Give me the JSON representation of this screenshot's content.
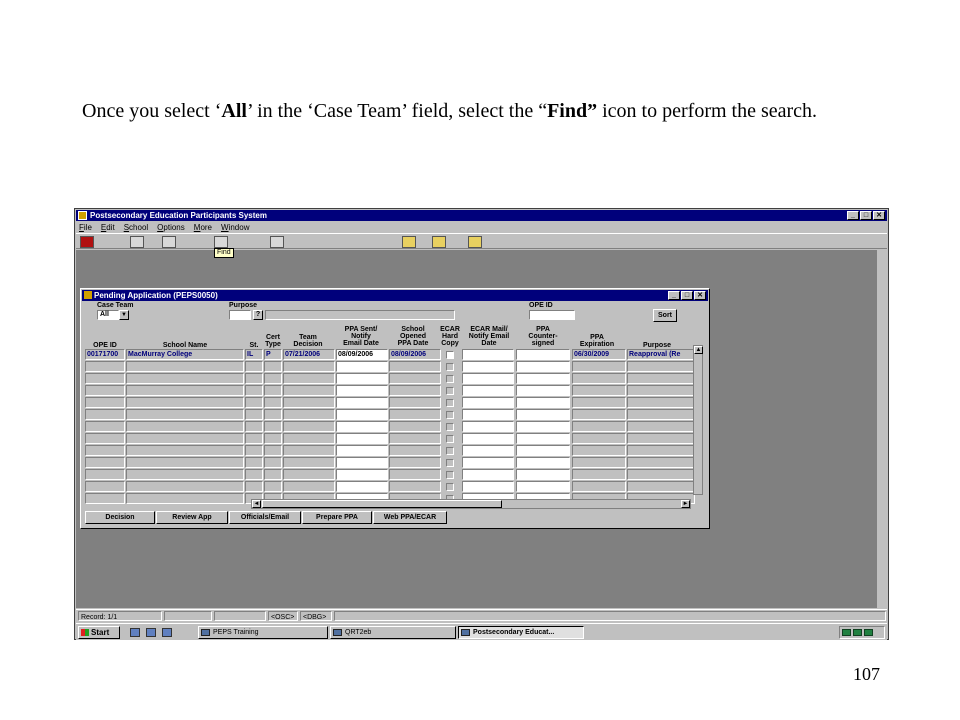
{
  "caption": {
    "part1": "Once you select ‘",
    "bold1": "All",
    "part2": "’ in the ‘Case Team’ field, select the “",
    "bold2": "Find”",
    "part3": " icon to perform the search."
  },
  "slide_number": "107",
  "app": {
    "title": "Postsecondary Education Participants System",
    "menu": [
      "File",
      "Edit",
      "School",
      "Options",
      "More",
      "Window"
    ],
    "tooltip": "Find"
  },
  "form": {
    "title": "Pending Application (PEPS0050)",
    "case_team_label": "Case  Team",
    "case_team_value": "All",
    "purpose_label": "Purpose",
    "ope_id_label": "OPE ID",
    "sort_label": "Sort",
    "columns": {
      "ope_id": "OPE ID",
      "school_name": "School Name",
      "st": "St.",
      "cert_type": "Cert\nType",
      "team_decision": "Team\nDecision",
      "ppa_sent": "PPA Sent/\nNotify\nEmail Date",
      "school_opened": "School\nOpened\nPPA Date",
      "ecar_copy": "ECAR\nHard\nCopy",
      "ecar_mail": "ECAR Mail/\nNotify Email\nDate",
      "ppa_counter": "PPA\nCounter-\nsigned",
      "ppa_expiration": "PPA\nExpiration",
      "purpose": "Purpose"
    },
    "first_row": {
      "ope_id": "00171700",
      "school_name": "MacMurray College",
      "st": "IL",
      "cert_type": "P",
      "team_decision": "07/21/2006",
      "ppa_sent": "08/09/2006",
      "school_opened": "08/09/2006",
      "ppa_expiration": "06/30/2009",
      "purpose": "Reapproval (Re"
    },
    "buttons": [
      "Decision",
      "Review App",
      "Officials/Email",
      "Prepare PPA",
      "Web PPA/ECAR"
    ]
  },
  "status": {
    "record": "Record: 1/1",
    "osc": "<OSC>",
    "dbg": "<DBG>"
  },
  "taskbar": {
    "start": "Start",
    "items": [
      "PEPS Training",
      "QRT2eb",
      "Postsecondary Educat..."
    ]
  }
}
